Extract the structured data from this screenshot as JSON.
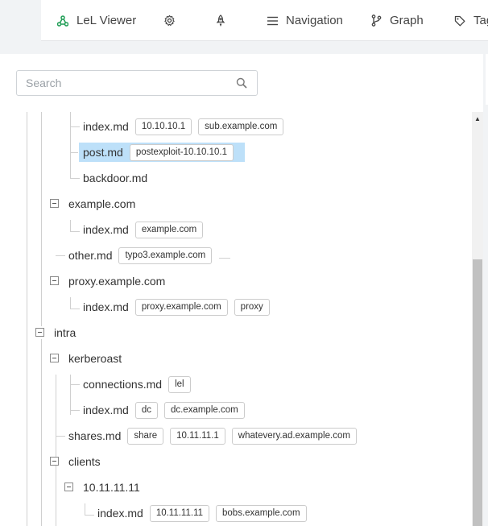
{
  "nav": {
    "app_title": "LeL Viewer",
    "navigation_label": "Navigation",
    "graph_label": "Graph",
    "tags_label": "Tags"
  },
  "search": {
    "placeholder": "Search",
    "value": ""
  },
  "tree": {
    "rows": [
      {
        "name": "index.md",
        "tags": [
          "10.10.10.1",
          "sub.example.com"
        ]
      },
      {
        "name": "post.md",
        "tags": [
          "postexploit-10.10.10.1"
        ],
        "selected": true
      },
      {
        "name": "backdoor.md",
        "tags": []
      },
      {
        "name": "example.com",
        "tags": [],
        "folder": true
      },
      {
        "name": "index.md",
        "tags": [
          "example.com"
        ]
      },
      {
        "name": "other.md",
        "tags": [
          "typo3.example.com"
        ]
      },
      {
        "name": "proxy.example.com",
        "tags": [],
        "folder": true
      },
      {
        "name": "index.md",
        "tags": [
          "proxy.example.com",
          "proxy"
        ]
      },
      {
        "name": "intra",
        "tags": [],
        "folder": true
      },
      {
        "name": "kerberoast",
        "tags": [],
        "folder": true
      },
      {
        "name": "connections.md",
        "tags": [
          "lel"
        ]
      },
      {
        "name": "index.md",
        "tags": [
          "dc",
          "dc.example.com"
        ]
      },
      {
        "name": "shares.md",
        "tags": [
          "share",
          "10.11.11.1",
          "whatevery.ad.example.com"
        ]
      },
      {
        "name": "clients",
        "tags": [],
        "folder": true
      },
      {
        "name": "10.11.11.11",
        "tags": [],
        "folder": true
      },
      {
        "name": "index.md",
        "tags": [
          "10.11.11.11",
          "bobs.example.com"
        ]
      }
    ]
  },
  "colors": {
    "selection": "#bde0f9",
    "accent_icon": "#1f9d55",
    "tree_lines": "#d0d0d0"
  },
  "icons": [
    "graph-logo-icon",
    "gear-icon",
    "rocket-icon",
    "menu-icon",
    "git-branch-icon",
    "tag-icon",
    "search-icon"
  ]
}
